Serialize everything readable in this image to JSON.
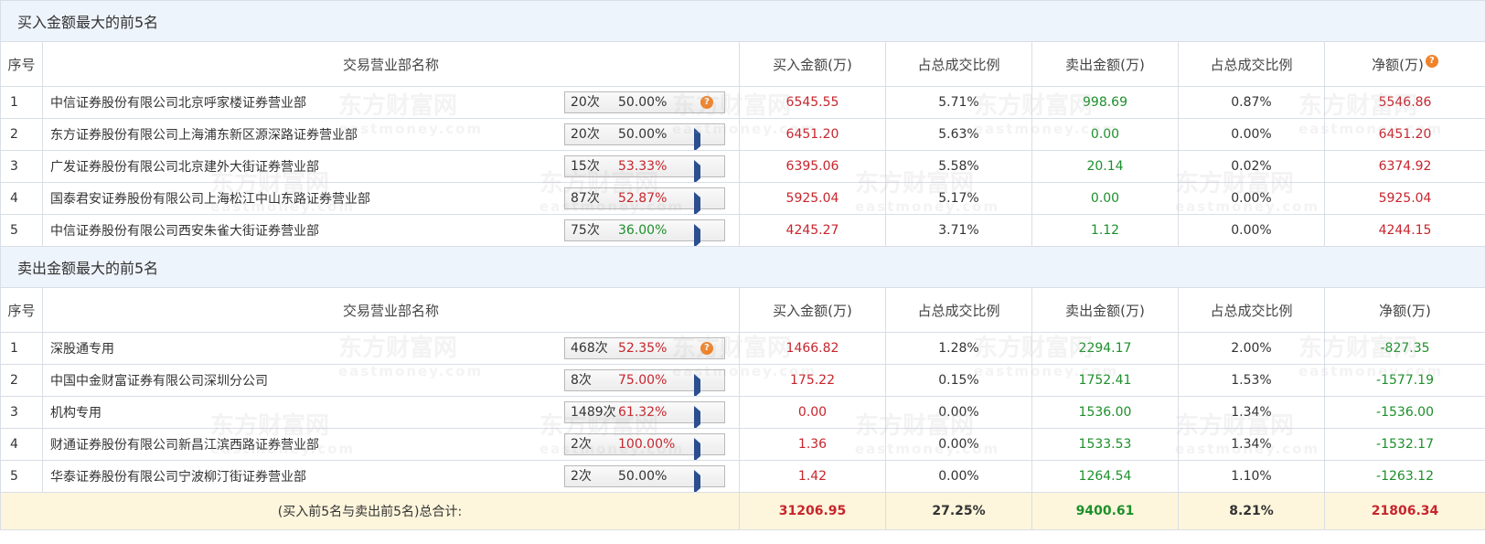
{
  "buy_section": {
    "title": "买入金额最大的前5名",
    "headers": [
      "序号",
      "交易营业部名称",
      "买入金额(万)",
      "占总成交比例",
      "卖出金额(万)",
      "占总成交比例",
      "净额(万)"
    ],
    "rows": [
      {
        "no": "1",
        "name": "中信证券股份有限公司北京呼家楼证券营业部",
        "count": "20次",
        "pct": "50.00%",
        "pct_color": "blk",
        "icon": "question-icon",
        "buy": "6545.55",
        "buy_ratio": "5.71%",
        "sell": "998.69",
        "sell_ratio": "0.87%",
        "net": "5546.86",
        "net_color": "red"
      },
      {
        "no": "2",
        "name": "东方证券股份有限公司上海浦东新区源深路证券营业部",
        "count": "20次",
        "pct": "50.00%",
        "pct_color": "blk",
        "icon": "play-icon",
        "buy": "6451.20",
        "buy_ratio": "5.63%",
        "sell": "0.00",
        "sell_ratio": "0.00%",
        "net": "6451.20",
        "net_color": "red"
      },
      {
        "no": "3",
        "name": "广发证券股份有限公司北京建外大街证券营业部",
        "count": "15次",
        "pct": "53.33%",
        "pct_color": "red",
        "icon": "play-icon",
        "buy": "6395.06",
        "buy_ratio": "5.58%",
        "sell": "20.14",
        "sell_ratio": "0.02%",
        "net": "6374.92",
        "net_color": "red"
      },
      {
        "no": "4",
        "name": "国泰君安证券股份有限公司上海松江中山东路证券营业部",
        "count": "87次",
        "pct": "52.87%",
        "pct_color": "red",
        "icon": "play-icon",
        "buy": "5925.04",
        "buy_ratio": "5.17%",
        "sell": "0.00",
        "sell_ratio": "0.00%",
        "net": "5925.04",
        "net_color": "red"
      },
      {
        "no": "5",
        "name": "中信证券股份有限公司西安朱雀大街证券营业部",
        "count": "75次",
        "pct": "36.00%",
        "pct_color": "green",
        "icon": "play-icon",
        "buy": "4245.27",
        "buy_ratio": "3.71%",
        "sell": "1.12",
        "sell_ratio": "0.00%",
        "net": "4244.15",
        "net_color": "red"
      }
    ]
  },
  "sell_section": {
    "title": "卖出金额最大的前5名",
    "headers": [
      "序号",
      "交易营业部名称",
      "买入金额(万)",
      "占总成交比例",
      "卖出金额(万)",
      "占总成交比例",
      "净额(万)"
    ],
    "rows": [
      {
        "no": "1",
        "name": "深股通专用",
        "count": "468次",
        "pct": "52.35%",
        "pct_color": "red",
        "icon": "question-icon",
        "buy": "1466.82",
        "buy_ratio": "1.28%",
        "sell": "2294.17",
        "sell_ratio": "2.00%",
        "net": "-827.35",
        "net_color": "green"
      },
      {
        "no": "2",
        "name": "中国中金财富证券有限公司深圳分公司",
        "count": "8次",
        "pct": "75.00%",
        "pct_color": "red",
        "icon": "play-icon",
        "buy": "175.22",
        "buy_ratio": "0.15%",
        "sell": "1752.41",
        "sell_ratio": "1.53%",
        "net": "-1577.19",
        "net_color": "green"
      },
      {
        "no": "3",
        "name": "机构专用",
        "count": "1489次",
        "pct": "61.32%",
        "pct_color": "red",
        "icon": "play-icon",
        "buy": "0.00",
        "buy_ratio": "0.00%",
        "sell": "1536.00",
        "sell_ratio": "1.34%",
        "net": "-1536.00",
        "net_color": "green"
      },
      {
        "no": "4",
        "name": "财通证券股份有限公司新昌江滨西路证券营业部",
        "count": "2次",
        "pct": "100.00%",
        "pct_color": "red",
        "icon": "play-icon",
        "buy": "1.36",
        "buy_ratio": "0.00%",
        "sell": "1533.53",
        "sell_ratio": "1.34%",
        "net": "-1532.17",
        "net_color": "green"
      },
      {
        "no": "5",
        "name": "华泰证券股份有限公司宁波柳汀街证券营业部",
        "count": "2次",
        "pct": "50.00%",
        "pct_color": "blk",
        "icon": "play-icon",
        "buy": "1.42",
        "buy_ratio": "0.00%",
        "sell": "1264.54",
        "sell_ratio": "1.10%",
        "net": "-1263.12",
        "net_color": "green"
      }
    ]
  },
  "total": {
    "label": "(买入前5名与卖出前5名)总合计:",
    "buy": "31206.95",
    "buy_ratio": "27.25%",
    "sell": "9400.61",
    "sell_ratio": "8.21%",
    "net": "21806.34"
  },
  "watermark": {
    "cn": "东方财富网",
    "en": "eastmoney.com"
  },
  "colors": {
    "red": "#c7252d",
    "green": "#1d8f2b",
    "section_bg": "#eef4fb",
    "total_bg": "#fdf6dc",
    "icon_orange": "#f0832a"
  }
}
